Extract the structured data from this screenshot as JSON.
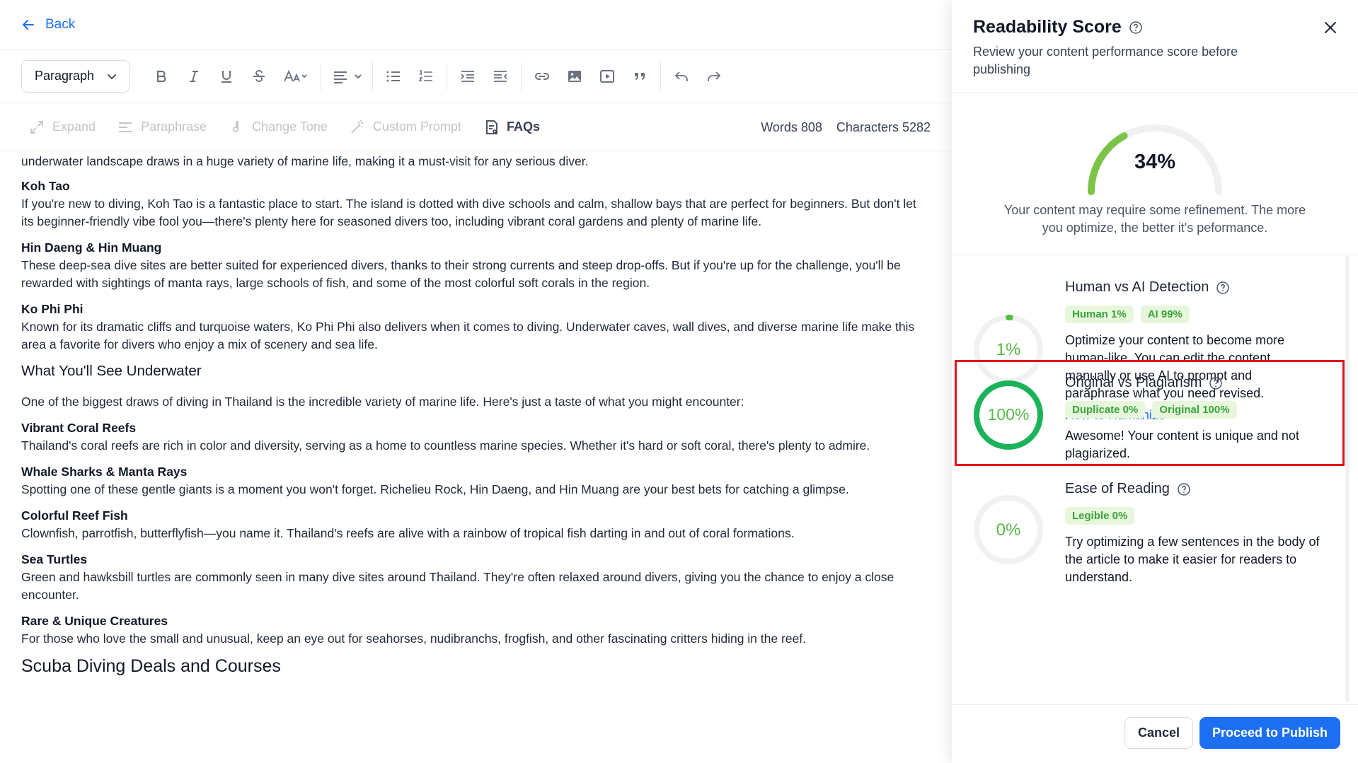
{
  "topbar": {
    "back_label": "Back"
  },
  "toolbar": {
    "paragraph_select": "Paragraph"
  },
  "aibar": {
    "tools": [
      "Expand",
      "Paraphrase",
      "Change Tone",
      "Custom Prompt",
      "FAQs"
    ],
    "words": "Words 808",
    "characters": "Characters 5282"
  },
  "content": {
    "intro": "underwater landscape draws in a huge variety of marine life, making it a must-visit for any serious diver.",
    "sections": [
      {
        "heading": "Koh Tao",
        "text": "If you're new to diving, Koh Tao is a fantastic place to start. The island is dotted with dive schools and calm, shallow bays that are perfect for beginners. But don't let its beginner-friendly vibe fool you—there's plenty here for seasoned divers too, including vibrant coral gardens and plenty of marine life."
      },
      {
        "heading": "Hin Daeng & Hin Muang",
        "text": "These deep-sea dive sites are better suited for experienced divers, thanks to their strong currents and steep drop-offs. But if you're up for the challenge, you'll be rewarded with sightings of manta rays, large schools of fish, and some of the most colorful soft corals in the region."
      },
      {
        "heading": "Ko Phi Phi",
        "text": "Known for its dramatic cliffs and turquoise waters, Ko Phi Phi also delivers when it comes to diving. Underwater caves, wall dives, and diverse marine life make this area a favorite for divers who enjoy a mix of scenery and sea life."
      }
    ],
    "subheading": "What You'll See Underwater",
    "sub_intro": "One of the biggest draws of diving in Thailand is the incredible variety of marine life. Here's just a taste of what you might encounter:",
    "sections2": [
      {
        "heading": "Vibrant Coral Reefs",
        "text": "Thailand's coral reefs are rich in color and diversity, serving as a home to countless marine species. Whether it's hard or soft coral, there's plenty to admire."
      },
      {
        "heading": "Whale Sharks & Manta Rays",
        "text": "Spotting one of these gentle giants is a moment you won't forget. Richelieu Rock, Hin Daeng, and Hin Muang are your best bets for catching a glimpse."
      },
      {
        "heading": "Colorful Reef Fish",
        "text": "Clownfish, parrotfish, butterflyfish—you name it. Thailand's reefs are alive with a rainbow of tropical fish darting in and out of coral formations."
      },
      {
        "heading": "Sea Turtles",
        "text": "Green and hawksbill turtles are commonly seen in many dive sites around Thailand. They're often relaxed around divers, giving you the chance to enjoy a close encounter."
      },
      {
        "heading": "Rare & Unique Creatures",
        "text": "For those who love the small and unusual, keep an eye out for seahorses, nudibranchs, frogfish, and other fascinating critters hiding in the reef."
      }
    ],
    "h2": "Scuba Diving Deals and Courses"
  },
  "panel": {
    "title": "Readability Score",
    "subtitle": "Review your content performance score before publishing",
    "score": "34%",
    "score_value": 34,
    "score_message": "Your content may require some refinement. The more you optimize, the better it's peformance.",
    "metrics": [
      {
        "title": "Human vs AI Detection",
        "value": "1%",
        "percent": 1,
        "tags": [
          "Human 1%",
          "AI 99%"
        ],
        "text": "Optimize your content to become more human-like. You can edit the content manually or use AI to prompt and paraphrase what you need revised.",
        "link": "How to Humanize"
      },
      {
        "title": "Original vs Plagiarism",
        "value": "100%",
        "percent": 100,
        "tags": [
          "Duplicate 0%",
          "Original 100%"
        ],
        "text": "Awesome! Your content is unique and not plagiarized."
      },
      {
        "title": "Ease of Reading",
        "value": "0%",
        "percent": 0,
        "tags": [
          "Legible 0%"
        ],
        "text": "Try optimizing a few sentences in the body of the article to make it easier for readers to understand."
      }
    ],
    "cancel_label": "Cancel",
    "publish_label": "Proceed to Publish"
  },
  "colors": {
    "accent": "#1d6ff2",
    "green": "#57b947",
    "ring_full": "#1bb35a",
    "highlight": "#e0141e"
  }
}
